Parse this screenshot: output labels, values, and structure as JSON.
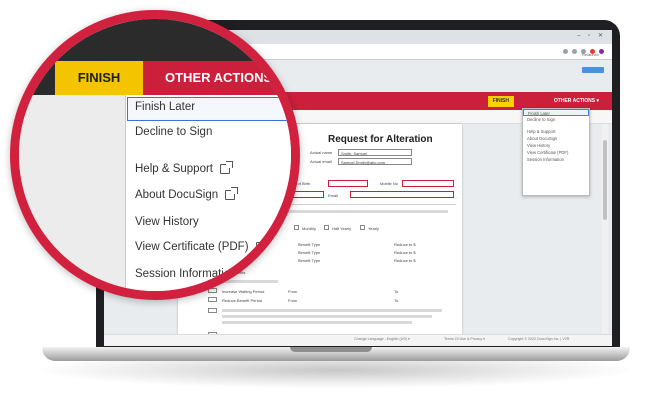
{
  "browser": {
    "window_controls": "–  ▫  ✕",
    "relaunch": "Relaunch ⋮"
  },
  "docusign_bar": {
    "finish_label": "FINISH",
    "other_actions_label": "OTHER ACTIONS ▾"
  },
  "other_actions_menu": {
    "items": [
      "Finish Later",
      "Decline to Sign",
      "Help & Support",
      "About DocuSign",
      "View History",
      "View Certificate (PDF)",
      "Session Information"
    ],
    "highlighted_item": "Finish Later"
  },
  "toolbar": {
    "icons": [
      "text-size-icon",
      "print-icon",
      "comment-icon",
      "settings-icon"
    ]
  },
  "document": {
    "title": "Request for Alteration",
    "field_labels": {
      "name": "Actual name",
      "email": "Actual email",
      "dob": "Date of Birth",
      "mobile": "Mobile No",
      "email2": "Email"
    },
    "field_values": {
      "name": "Smith, Samuel",
      "email": "Samuel.Smith@abc.com"
    },
    "frequency_options": [
      "Monthly",
      "Half Yearly",
      "Yearly"
    ],
    "benefit_rows": [
      {
        "label": "Benefit Type",
        "value": "Reduce to $"
      },
      {
        "label": "Benefit Type",
        "value": "Reduce to $"
      },
      {
        "label": "Benefit Type",
        "value": "Reduce to $"
      }
    ],
    "benefit_section": "Option Benefits",
    "increase_option": "Increase Waiting Period",
    "reduce_option": "Reduce Benefit Period",
    "convert_option": "Change Premium Structure",
    "from_label": "From",
    "to_label": "To"
  },
  "footer": {
    "language": "Change Language - English (US) ▾",
    "terms": "Terms Of Use & Privacy ▾",
    "copyright": "Copyright © 2022 DocuSign Inc. | V2R"
  },
  "colors": {
    "brand_red": "#cc1f3b",
    "finish_yellow": "#f5c400",
    "highlight_blue": "#3d70d6"
  }
}
